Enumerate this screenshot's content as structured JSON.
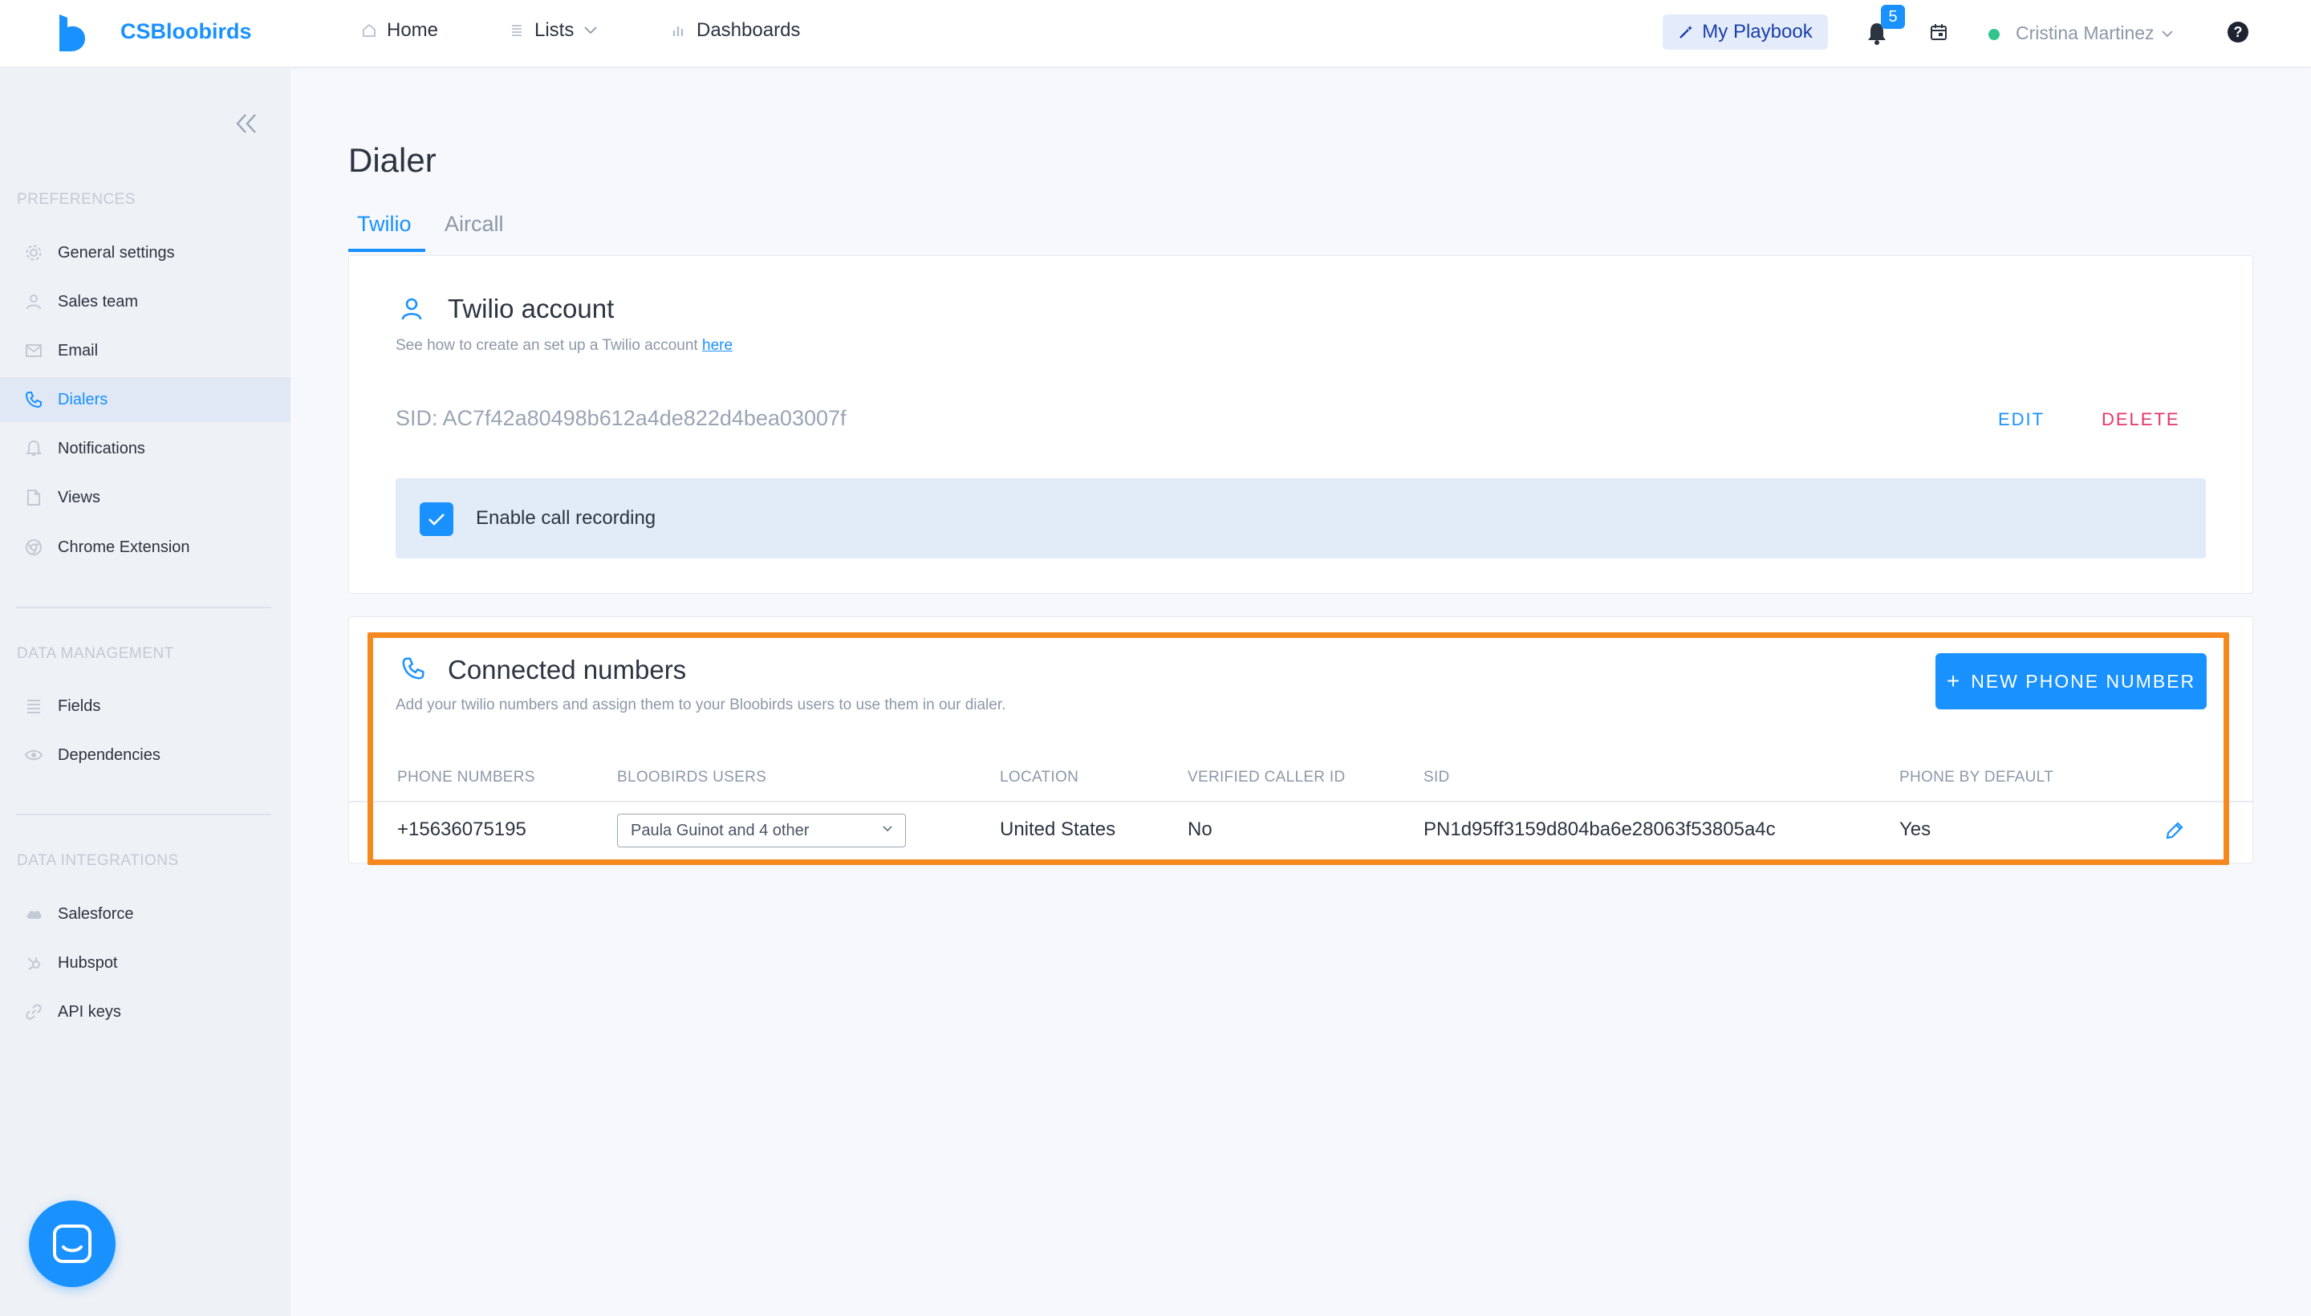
{
  "header": {
    "brand": "CSBloobirds",
    "nav": {
      "home": "Home",
      "lists": "Lists",
      "dashboards": "Dashboards"
    },
    "playbook_label": "My Playbook",
    "notifications_count": "5",
    "user_name": "Cristina Martinez",
    "help_glyph": "?"
  },
  "sidebar": {
    "preferences_title": "PREFERENCES",
    "preferences": [
      {
        "label": "General settings",
        "icon": "gear-icon"
      },
      {
        "label": "Sales team",
        "icon": "user-icon"
      },
      {
        "label": "Email",
        "icon": "mail-icon"
      },
      {
        "label": "Dialers",
        "icon": "phone-icon"
      },
      {
        "label": "Notifications",
        "icon": "bell-icon"
      },
      {
        "label": "Views",
        "icon": "file-icon"
      },
      {
        "label": "Chrome Extension",
        "icon": "chrome-icon"
      }
    ],
    "active_item": "Dialers",
    "data_management_title": "DATA MANAGEMENT",
    "data_management": [
      {
        "label": "Fields",
        "icon": "list-icon"
      },
      {
        "label": "Dependencies",
        "icon": "eye-icon"
      }
    ],
    "data_integrations_title": "DATA INTEGRATIONS",
    "data_integrations": [
      {
        "label": "Salesforce",
        "icon": "cloud-icon"
      },
      {
        "label": "Hubspot",
        "icon": "hubspot-icon"
      },
      {
        "label": "API keys",
        "icon": "link-icon"
      }
    ]
  },
  "main": {
    "title": "Dialer",
    "tabs": [
      {
        "label": "Twilio",
        "active": true
      },
      {
        "label": "Aircall",
        "active": false
      }
    ],
    "account": {
      "title": "Twilio account",
      "subtitle": "See how to create an set up a Twilio account",
      "link_text": "here",
      "sid": "SID: AC7f42a80498b612a4de822d4bea03007f",
      "edit_label": "EDIT",
      "delete_label": "DELETE",
      "recording_label": "Enable call recording",
      "recording_enabled": true
    },
    "numbers": {
      "title": "Connected numbers",
      "subtitle": "Add your twilio numbers and assign them to your Bloobirds users to use them in our dialer.",
      "new_button": "NEW PHONE NUMBER",
      "new_button_icon": "+",
      "columns": [
        "PHONE NUMBERS",
        "BLOOBIRDS USERS",
        "LOCATION",
        "VERIFIED CALLER ID",
        "SID",
        "PHONE BY DEFAULT"
      ],
      "rows": [
        {
          "phone": "+15636075195",
          "users": "Paula Guinot and 4 other",
          "location": "United States",
          "verified": "No",
          "sid": "PN1d95ff3159d804ba6e28063f53805a4c",
          "default": "Yes"
        }
      ]
    }
  },
  "colors": {
    "accent": "#1991ff",
    "danger": "#e8336a",
    "highlight": "#f5891f"
  }
}
